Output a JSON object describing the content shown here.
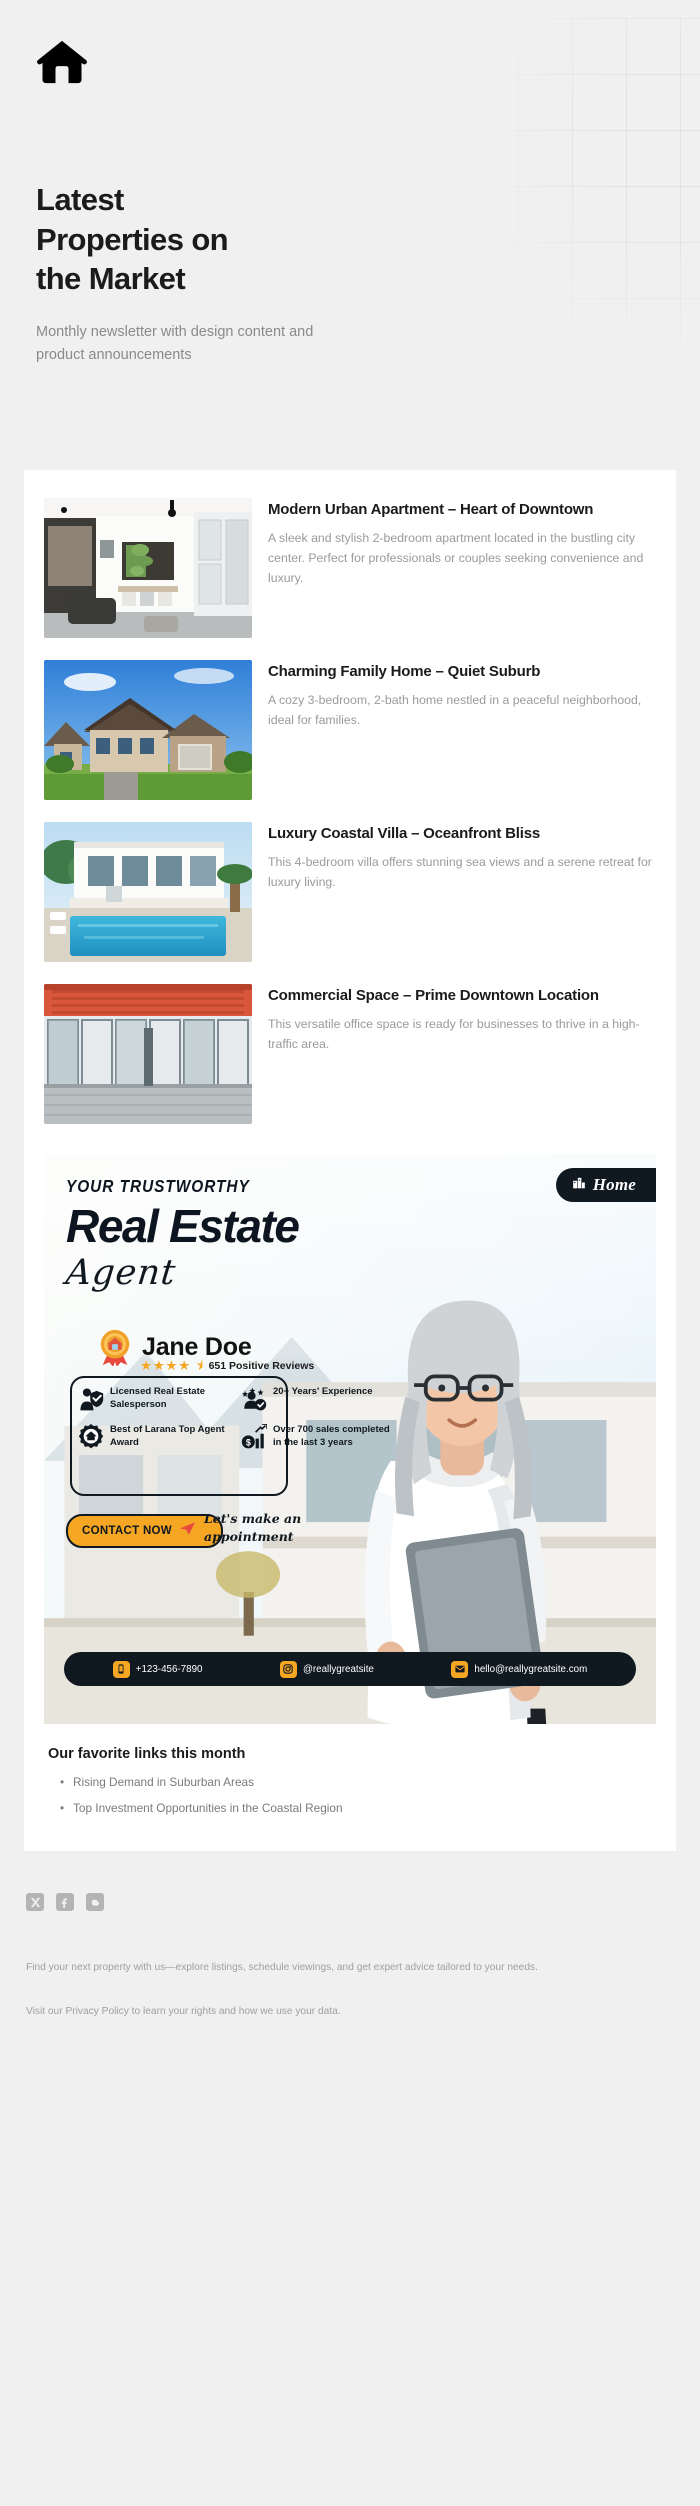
{
  "header": {
    "logo_icon": "home-icon",
    "title": "Latest Properties on the Market",
    "title_line1": "Latest",
    "title_line2": "Properties on",
    "title_line3": "the Market",
    "subtitle": "Monthly newsletter with design content and product announcements"
  },
  "properties": [
    {
      "title": "Modern Urban Apartment – Heart of Downtown",
      "description": "A sleek and stylish 2-bedroom apartment located in the bustling city center. Perfect for professionals or couples seeking convenience and luxury.",
      "image_alt": "modern-apartment-interior"
    },
    {
      "title": "Charming Family Home – Quiet Suburb",
      "description": "A cozy 3-bedroom, 2-bath home nestled in a peaceful neighborhood, ideal for families.",
      "image_alt": "suburban-family-house"
    },
    {
      "title": "Luxury Coastal Villa – Oceanfront Bliss",
      "description": "This 4-bedroom villa offers stunning sea views and a serene retreat for luxury living.",
      "image_alt": "coastal-villa-with-pool"
    },
    {
      "title": "Commercial Space – Prime Downtown Location",
      "description": "This versatile office space is ready for businesses to thrive in a high-traffic area.",
      "image_alt": "commercial-office-building"
    }
  ],
  "ad": {
    "badge_label": "Home",
    "badge_icon": "building-icon",
    "kicker": "YOUR TRUSTWORTHY",
    "headline": "Real Estate",
    "script_word": "Agent",
    "agent_name": "Jane Doe",
    "rosette_icon": "award-rosette-icon",
    "stars": "★★★★",
    "half_star": "⯨",
    "review_count": "651 Positive Reviews",
    "features": [
      {
        "icon": "licensed-agent-icon",
        "text": "Licensed Real Estate Salesperson"
      },
      {
        "icon": "experience-group-icon",
        "text": "20+ Years' Experience"
      },
      {
        "icon": "top-agent-award-icon",
        "text": "Best of Larana Top Agent Award"
      },
      {
        "icon": "sales-chart-icon",
        "text": "Over 700 sales completed in the last 3 years"
      }
    ],
    "cta_label": "CONTACT NOW",
    "cta_icon": "send-arrow-icon",
    "appointment_line1": "Let's make an",
    "appointment_line2": "appointment",
    "contacts": [
      {
        "icon": "phone-icon",
        "text": "+123-456-7890"
      },
      {
        "icon": "instagram-icon",
        "text": "@reallygreatsite"
      },
      {
        "icon": "email-icon",
        "text": "hello@reallygreatsite.com"
      }
    ]
  },
  "links_section": {
    "title": "Our favorite links this month",
    "items": [
      "Rising Demand in Suburban Areas",
      "Top Investment Opportunities in the Coastal Region"
    ]
  },
  "footer": {
    "socials": [
      {
        "name": "x-twitter-icon"
      },
      {
        "name": "facebook-icon"
      },
      {
        "name": "blogger-icon"
      }
    ],
    "paragraph1": "Find your next property with us—explore listings, schedule viewings, and get expert advice tailored to your needs.",
    "paragraph2": "Visit our Privacy Policy to learn your rights and how we use your data."
  },
  "colors": {
    "page_bg": "#f0f0f0",
    "sheet_bg": "#ffffff",
    "ink": "#1b1b1b",
    "muted": "#9a9a9a",
    "accent_gold": "#f5a623",
    "dark": "#101820"
  }
}
